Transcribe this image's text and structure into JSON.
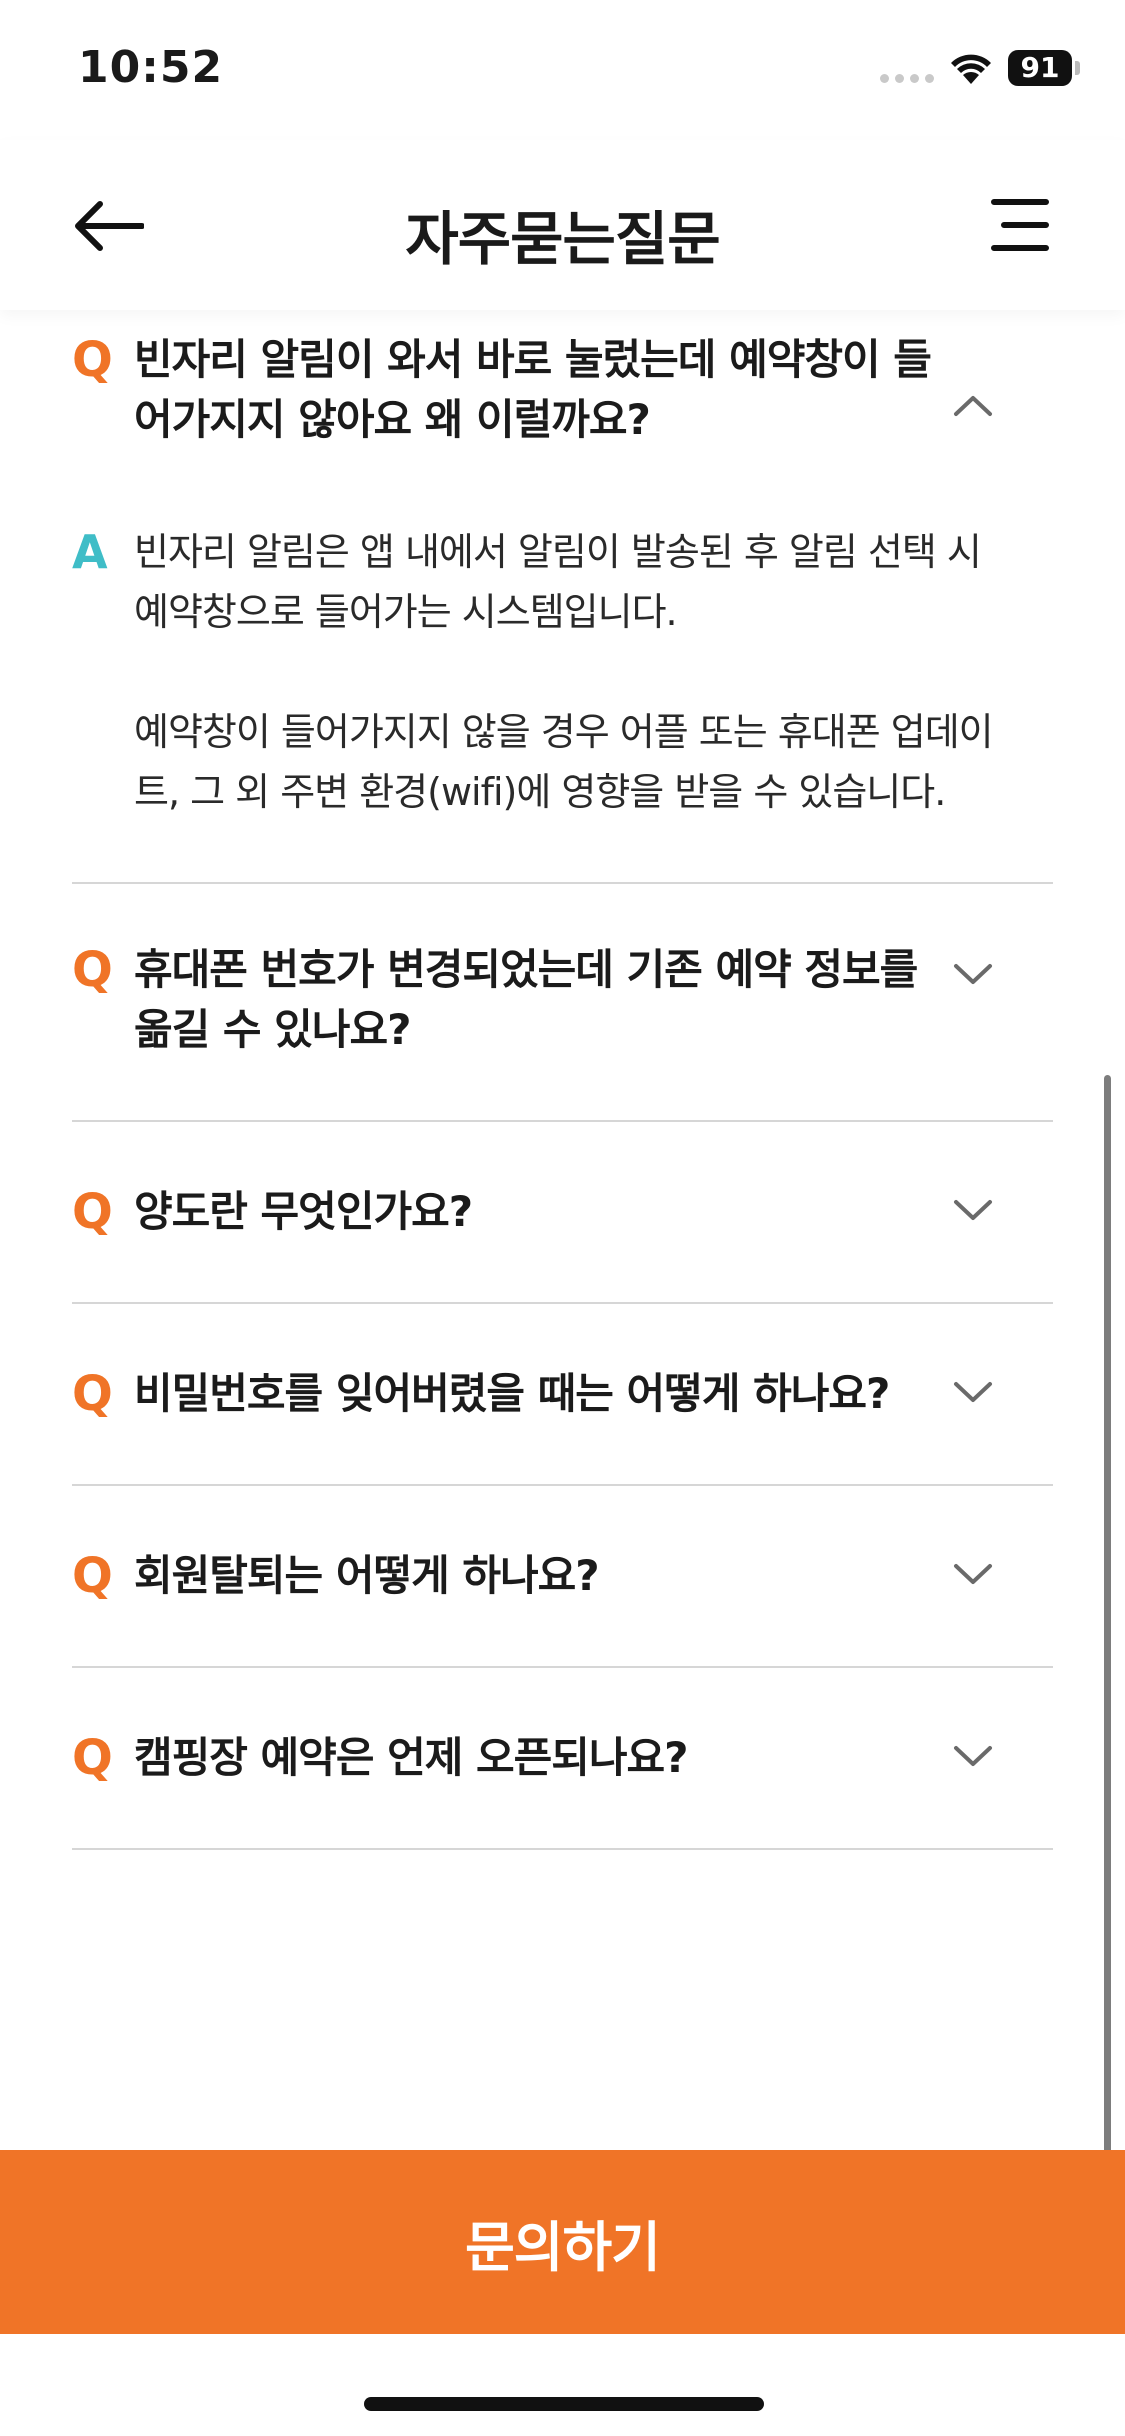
{
  "status_bar": {
    "time": "10:52",
    "battery": "91"
  },
  "header": {
    "title": "자주묻는질문"
  },
  "faq": {
    "q_mark": "Q",
    "a_mark": "A",
    "items": [
      {
        "question": "빈자리 알림이 와서 바로 눌렀는데 예약창이 들어가지지 않아요 왜 이럴까요?",
        "expanded": true,
        "answer": [
          "빈자리 알림은 앱 내에서 알림이 발송된 후 알림 선택 시 예약창으로 들어가는 시스템입니다.",
          "예약창이 들어가지지 않을 경우 어플 또는 휴대폰 업데이트, 그 외 주변 환경(wifi)에 영향을 받을 수 있습니다."
        ]
      },
      {
        "question": "휴대폰 번호가 변경되었는데 기존 예약 정보를 옮길 수 있나요?",
        "expanded": false
      },
      {
        "question": "양도란 무엇인가요?",
        "expanded": false
      },
      {
        "question": "비밀번호를 잊어버렸을 때는 어떻게 하나요?",
        "expanded": false
      },
      {
        "question": "회원탈퇴는 어떻게 하나요?",
        "expanded": false
      },
      {
        "question": "캠핑장 예약은 언제 오픈되나요?",
        "expanded": false
      }
    ]
  },
  "footer": {
    "button_label": "문의하기"
  },
  "colors": {
    "accent": "#f07427",
    "answer_mark": "#3fbdc7",
    "divider": "#d6d6d6"
  }
}
